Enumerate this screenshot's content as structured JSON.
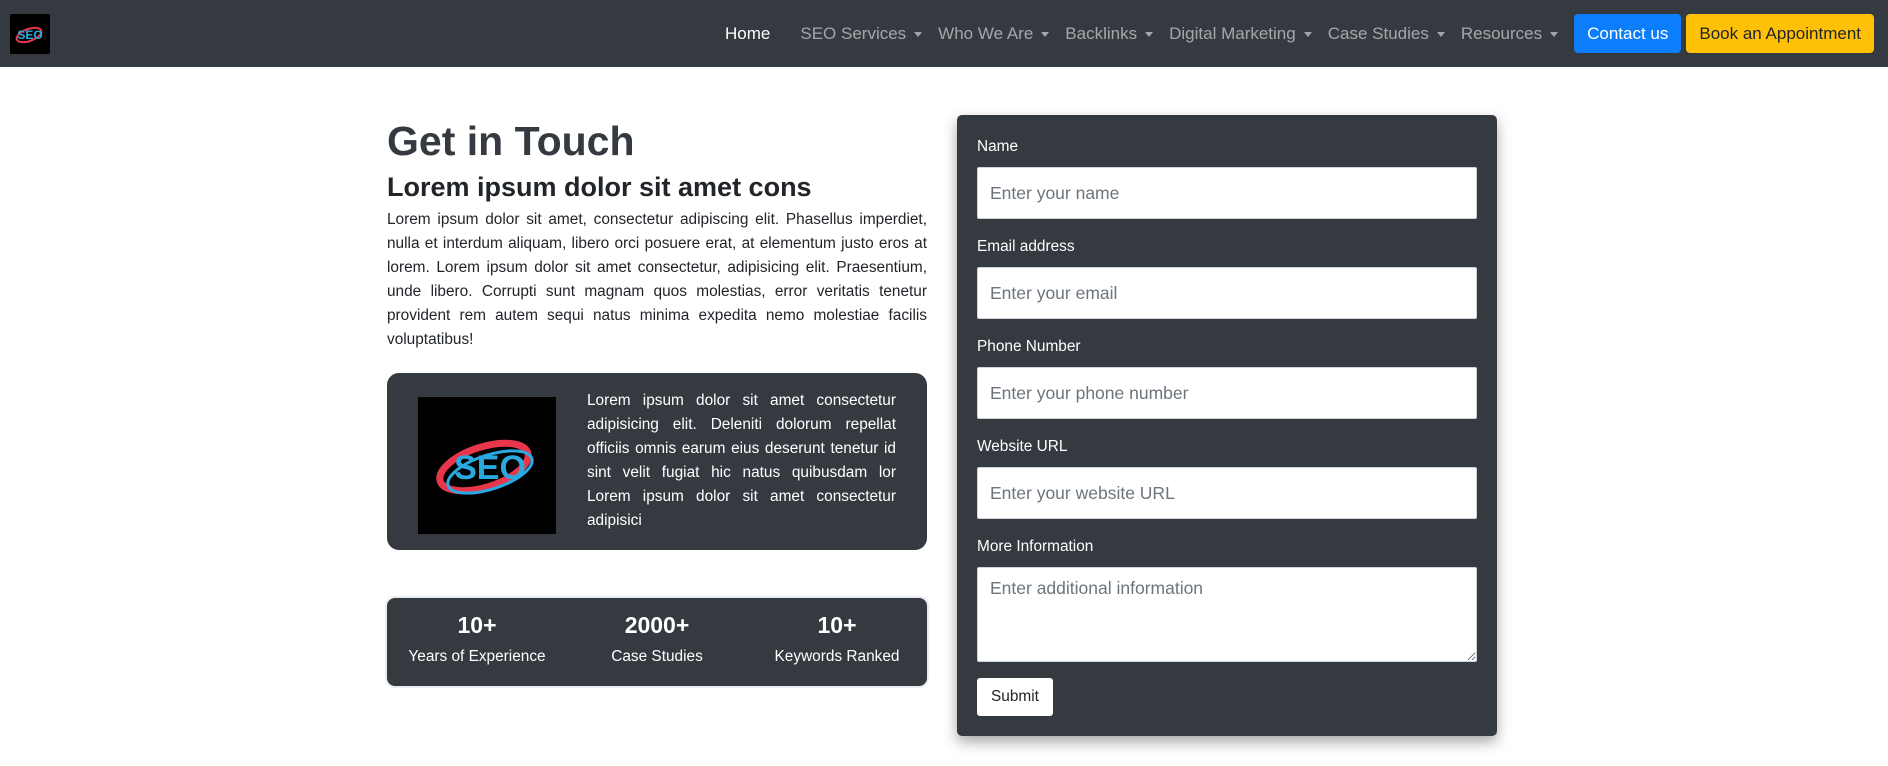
{
  "nav": {
    "logo_text": "SEO",
    "home": "Home",
    "items": [
      "SEO Services",
      "Who We Are",
      "Backlinks",
      "Digital Marketing",
      "Case Studies",
      "Resources"
    ],
    "contact": "Contact us",
    "book": "Book an Appointment"
  },
  "main": {
    "title": "Get in Touch",
    "subtitle": "Lorem ipsum dolor sit amet cons",
    "intro": "Lorem ipsum dolor sit amet, consectetur adipiscing elit. Phasellus imperdiet, nulla et interdum aliquam, libero orci posuere erat, at elementum justo eros at lorem. Lorem ipsum dolor sit amet consectetur, adipisicing elit. Praesentium, unde libero. Corrupti sunt magnam quos molestias, error veritatis tenetur provident rem autem sequi natus minima expedita nemo molestiae facilis voluptatibus!",
    "card_logo_text": "SEO",
    "card_text": "Lorem ipsum dolor sit amet consectetur adipisicing elit. Deleniti dolorum repellat officiis omnis earum eius deserunt tenetur id sint velit fugiat hic natus quibusdam lor Lorem ipsum dolor sit amet consectetur adipisici",
    "stats": [
      {
        "value": "10+",
        "label": "Years of Experience"
      },
      {
        "value": "2000+",
        "label": "Case Studies"
      },
      {
        "value": "10+",
        "label": "Keywords Ranked"
      }
    ]
  },
  "form": {
    "name_label": "Name",
    "name_placeholder": "Enter your name",
    "email_label": "Email address",
    "email_placeholder": "Enter your email",
    "phone_label": "Phone Number",
    "phone_placeholder": "Enter your phone number",
    "website_label": "Website URL",
    "website_placeholder": "Enter your website URL",
    "info_label": "More Information",
    "info_placeholder": "Enter additional information",
    "submit": "Submit"
  },
  "colors": {
    "dark": "#343a40",
    "primary": "#0d7efb",
    "warning": "#ffc107",
    "logo_red": "#e8374a",
    "logo_blue": "#29a9e0"
  }
}
